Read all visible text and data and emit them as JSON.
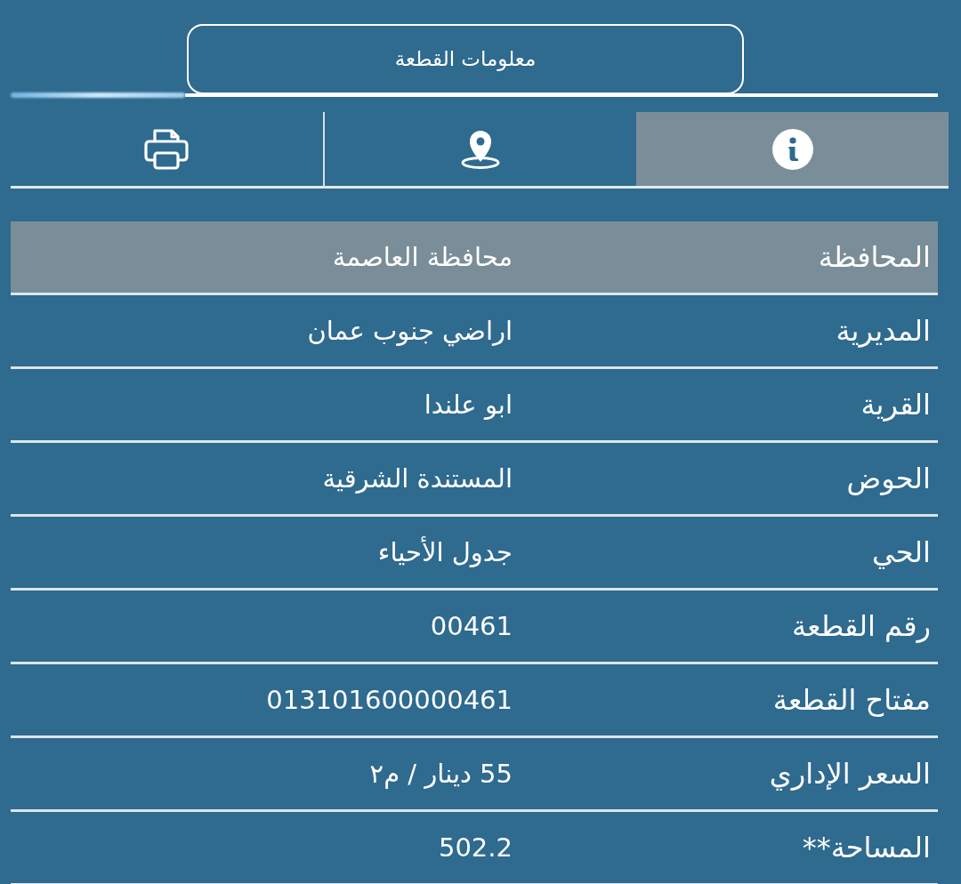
{
  "title": "معلومات القطعة",
  "tabs": [
    {
      "kind": "info",
      "selected": true
    },
    {
      "kind": "location",
      "selected": false
    },
    {
      "kind": "print",
      "selected": false
    }
  ],
  "rows": [
    {
      "label": "المحافظة",
      "value": "محافظة العاصمة",
      "selected": true
    },
    {
      "label": "المديرية",
      "value": "اراضي جنوب عمان",
      "selected": false
    },
    {
      "label": "القرية",
      "value": "ابو علندا",
      "selected": false
    },
    {
      "label": "الحوض",
      "value": "المستندة الشرقية",
      "selected": false
    },
    {
      "label": "الحي",
      "value": "جدول الأحياء",
      "selected": false
    },
    {
      "label": "رقم القطعة",
      "value": "00461",
      "selected": false
    },
    {
      "label": "مفتاح القطعة",
      "value": "013101600000461",
      "selected": false
    },
    {
      "label": "السعر الإداري",
      "value": "55 دينار / م٢",
      "selected": false
    },
    {
      "label": "المساحة**",
      "value": "502.2",
      "selected": false
    }
  ]
}
